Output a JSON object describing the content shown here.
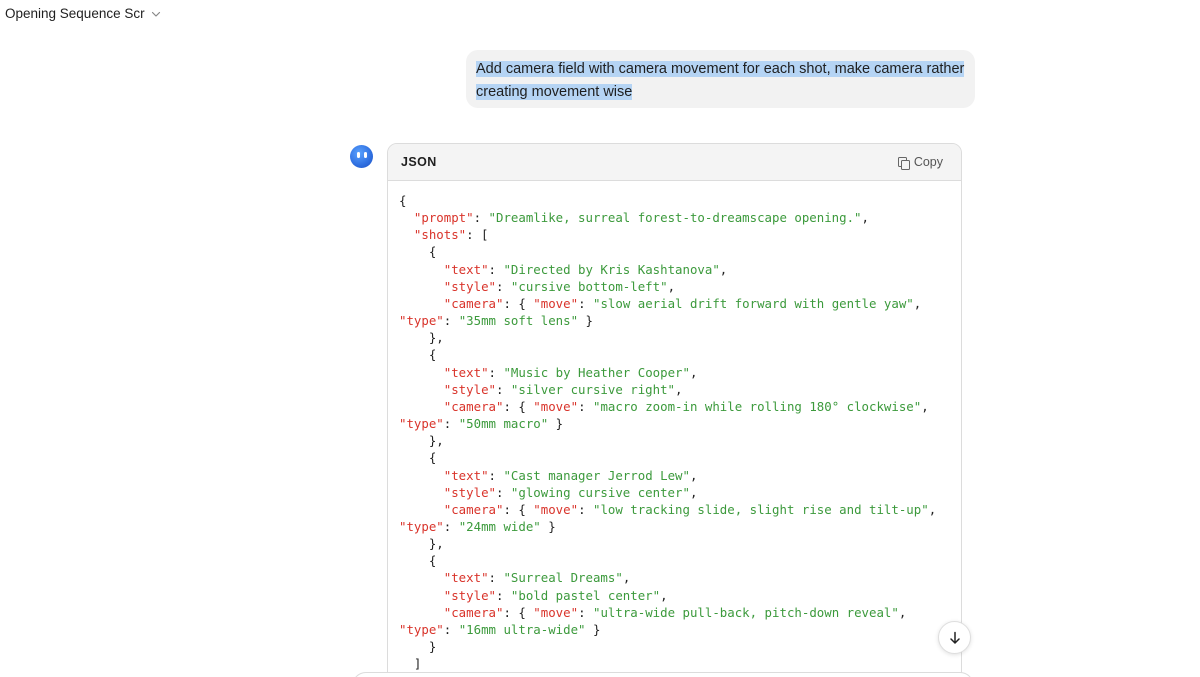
{
  "header": {
    "title": "Opening Sequence Scr"
  },
  "user_message": {
    "text": "Add camera field with camera movement for each shot, make camera rather creating movement wise"
  },
  "code_block": {
    "language": "JSON",
    "copy_label": "Copy",
    "lines": [
      [
        [
          "p",
          "{"
        ]
      ],
      [
        [
          "p",
          "  "
        ],
        [
          "k",
          "\"prompt\""
        ],
        [
          "p",
          ": "
        ],
        [
          "s",
          "\"Dreamlike, surreal forest-to-dreamscape opening.\""
        ],
        [
          "p",
          ","
        ]
      ],
      [
        [
          "p",
          "  "
        ],
        [
          "k",
          "\"shots\""
        ],
        [
          "p",
          ": ["
        ]
      ],
      [
        [
          "p",
          "    {"
        ]
      ],
      [
        [
          "p",
          "      "
        ],
        [
          "k",
          "\"text\""
        ],
        [
          "p",
          ": "
        ],
        [
          "s",
          "\"Directed by Kris Kashtanova\""
        ],
        [
          "p",
          ","
        ]
      ],
      [
        [
          "p",
          "      "
        ],
        [
          "k",
          "\"style\""
        ],
        [
          "p",
          ": "
        ],
        [
          "s",
          "\"cursive bottom-left\""
        ],
        [
          "p",
          ","
        ]
      ],
      [
        [
          "p",
          "      "
        ],
        [
          "k",
          "\"camera\""
        ],
        [
          "p",
          ": { "
        ],
        [
          "k",
          "\"move\""
        ],
        [
          "p",
          ": "
        ],
        [
          "s",
          "\"slow aerial drift forward with gentle yaw\""
        ],
        [
          "p",
          ","
        ]
      ],
      [
        [
          "k",
          "\"type\""
        ],
        [
          "p",
          ": "
        ],
        [
          "s",
          "\"35mm soft lens\""
        ],
        [
          "p",
          " }"
        ]
      ],
      [
        [
          "p",
          "    },"
        ]
      ],
      [
        [
          "p",
          "    {"
        ]
      ],
      [
        [
          "p",
          "      "
        ],
        [
          "k",
          "\"text\""
        ],
        [
          "p",
          ": "
        ],
        [
          "s",
          "\"Music by Heather Cooper\""
        ],
        [
          "p",
          ","
        ]
      ],
      [
        [
          "p",
          "      "
        ],
        [
          "k",
          "\"style\""
        ],
        [
          "p",
          ": "
        ],
        [
          "s",
          "\"silver cursive right\""
        ],
        [
          "p",
          ","
        ]
      ],
      [
        [
          "p",
          "      "
        ],
        [
          "k",
          "\"camera\""
        ],
        [
          "p",
          ": { "
        ],
        [
          "k",
          "\"move\""
        ],
        [
          "p",
          ": "
        ],
        [
          "s",
          "\"macro zoom-in while rolling 180° clockwise\""
        ],
        [
          "p",
          ","
        ]
      ],
      [
        [
          "k",
          "\"type\""
        ],
        [
          "p",
          ": "
        ],
        [
          "s",
          "\"50mm macro\""
        ],
        [
          "p",
          " }"
        ]
      ],
      [
        [
          "p",
          "    },"
        ]
      ],
      [
        [
          "p",
          "    {"
        ]
      ],
      [
        [
          "p",
          "      "
        ],
        [
          "k",
          "\"text\""
        ],
        [
          "p",
          ": "
        ],
        [
          "s",
          "\"Cast manager Jerrod Lew\""
        ],
        [
          "p",
          ","
        ]
      ],
      [
        [
          "p",
          "      "
        ],
        [
          "k",
          "\"style\""
        ],
        [
          "p",
          ": "
        ],
        [
          "s",
          "\"glowing cursive center\""
        ],
        [
          "p",
          ","
        ]
      ],
      [
        [
          "p",
          "      "
        ],
        [
          "k",
          "\"camera\""
        ],
        [
          "p",
          ": { "
        ],
        [
          "k",
          "\"move\""
        ],
        [
          "p",
          ": "
        ],
        [
          "s",
          "\"low tracking slide, slight rise and tilt-up\""
        ],
        [
          "p",
          ","
        ]
      ],
      [
        [
          "k",
          "\"type\""
        ],
        [
          "p",
          ": "
        ],
        [
          "s",
          "\"24mm wide\""
        ],
        [
          "p",
          " }"
        ]
      ],
      [
        [
          "p",
          "    },"
        ]
      ],
      [
        [
          "p",
          "    {"
        ]
      ],
      [
        [
          "p",
          "      "
        ],
        [
          "k",
          "\"text\""
        ],
        [
          "p",
          ": "
        ],
        [
          "s",
          "\"Surreal Dreams\""
        ],
        [
          "p",
          ","
        ]
      ],
      [
        [
          "p",
          "      "
        ],
        [
          "k",
          "\"style\""
        ],
        [
          "p",
          ": "
        ],
        [
          "s",
          "\"bold pastel center\""
        ],
        [
          "p",
          ","
        ]
      ],
      [
        [
          "p",
          "      "
        ],
        [
          "k",
          "\"camera\""
        ],
        [
          "p",
          ": { "
        ],
        [
          "k",
          "\"move\""
        ],
        [
          "p",
          ": "
        ],
        [
          "s",
          "\"ultra-wide pull-back, pitch-down reveal\""
        ],
        [
          "p",
          ","
        ]
      ],
      [
        [
          "k",
          "\"type\""
        ],
        [
          "p",
          ": "
        ],
        [
          "s",
          "\"16mm ultra-wide\""
        ],
        [
          "p",
          " }"
        ]
      ],
      [
        [
          "p",
          "    }"
        ]
      ],
      [
        [
          "p",
          "  ]"
        ]
      ]
    ]
  },
  "icons": {
    "chevron": "chevron-down-icon",
    "copy": "copy-icon",
    "scroll": "arrow-down-icon",
    "assistant": "assistant-avatar"
  },
  "colors": {
    "json_key": "#d9342b",
    "json_string": "#3c9a3c",
    "selection_highlight": "#b5d4f4",
    "bubble_bg": "#f2f2f2"
  }
}
